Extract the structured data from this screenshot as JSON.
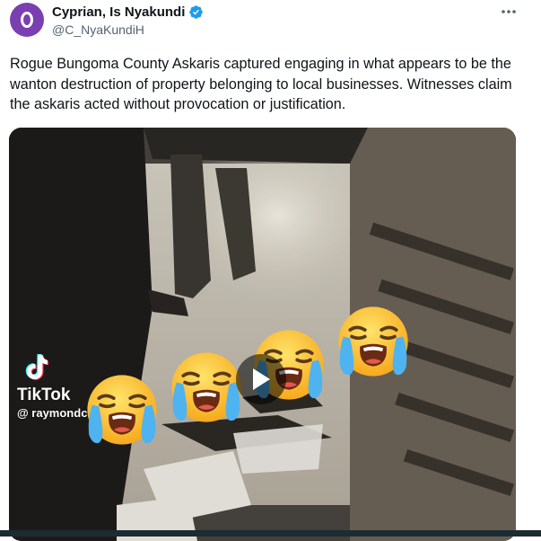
{
  "author": {
    "display_name": "Cyprian, Is Nyakundi",
    "handle": "@C_NyaKundiH",
    "verified_icon": "verified-badge-icon",
    "avatar_color": "#7a3fb0"
  },
  "more_icon": "more-dots-icon",
  "tweet": {
    "text": "Rogue Bungoma County Askaris captured engaging in what appears to be the wanton destruction of property belonging to local businesses. Witnesses claim the askaris acted without provocation or justification."
  },
  "video": {
    "watermark_brand": "TikTok",
    "watermark_user": "@ raymondchambo",
    "play_icon": "play-icon",
    "overlay_emoji": "loudly-crying-face",
    "accent_color": "#1d9bf0"
  }
}
